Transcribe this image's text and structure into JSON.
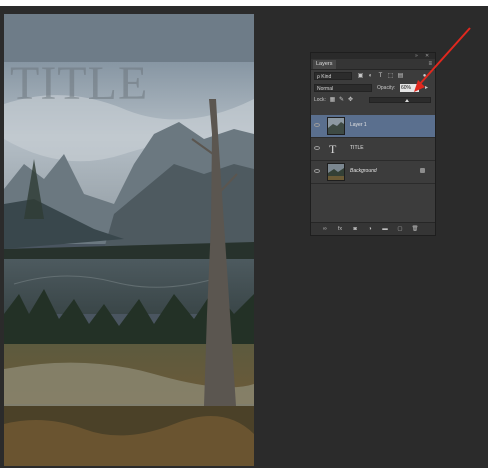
{
  "document": {
    "title_text": "TITLE"
  },
  "layers_panel": {
    "tab_label": "Layers",
    "menu_icon": "panel-menu-icon",
    "filter": {
      "value": "ρ Kind"
    },
    "blend_mode": {
      "value": "Normal"
    },
    "opacity": {
      "label": "Opacity:",
      "value": "60%"
    },
    "lock": {
      "label": "Lock:"
    },
    "layers": [
      {
        "name": "Layer 1",
        "type": "image",
        "selected": true
      },
      {
        "name": "TITLE",
        "type": "text",
        "selected": false
      },
      {
        "name": "Background",
        "type": "background",
        "selected": false
      }
    ],
    "footer_icons": [
      "link-icon",
      "fx-icon",
      "mask-icon",
      "adjustment-icon",
      "folder-icon",
      "new-layer-icon",
      "trash-icon"
    ]
  },
  "colors": {
    "workspace": "#2b2b2b",
    "panel": "#3c3c3c",
    "selected_layer": "#5a6f8e",
    "annotation_arrow": "#e0281e"
  }
}
